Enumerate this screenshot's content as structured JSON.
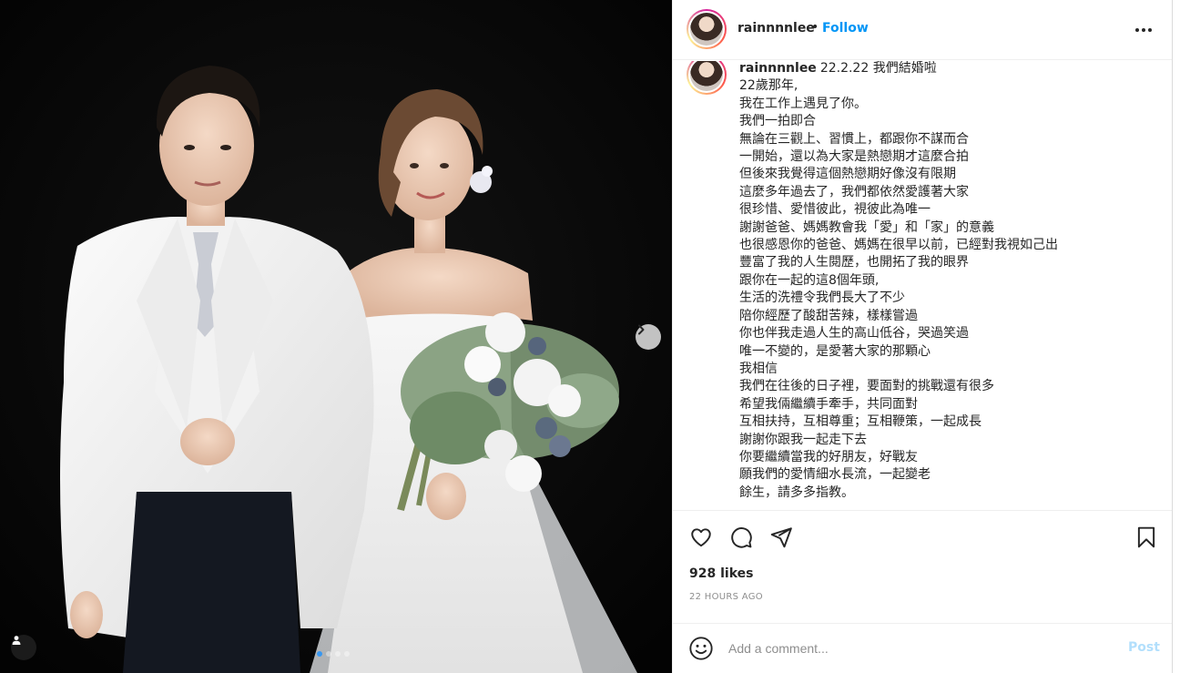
{
  "post": {
    "username": "rainnnnlee",
    "separator": "•",
    "follow_label": "Follow",
    "more_icon": "more-horizontal-icon"
  },
  "caption": {
    "username": "rainnnnlee",
    "lines": [
      "22.2.22 我們結婚啦",
      "22歲那年,",
      "我在工作上遇見了你。",
      "我們一拍即合",
      "無論在三觀上、習慣上，都跟你不謀而合",
      "一開始，還以為大家是熱戀期才這麼合拍",
      "但後來我覺得這個熱戀期好像沒有限期",
      "這麼多年過去了，我們都依然愛護著大家",
      "很珍惜、愛惜彼此，視彼此為唯一",
      "謝謝爸爸、媽媽教會我「愛」和「家」的意義",
      "也很感恩你的爸爸、媽媽在很早以前，已經對我視如己出",
      "豐富了我的人生閱歷，也開拓了我的眼界",
      "跟你在一起的這8個年頭,",
      "生活的洗禮令我們長大了不少",
      "陪你經歷了酸甜苦辣，樣樣嘗過",
      "你也伴我走過人生的高山低谷，哭過笑過",
      "唯一不變的，是愛著大家的那顆心",
      "我相信",
      "我們在往後的日子裡，要面對的挑戰還有很多",
      "希望我倆繼續手牽手，共同面對",
      "互相扶持，互相尊重；互相鞭策，一起成長",
      "謝謝你跟我一起走下去",
      "你要繼續當我的好朋友，好戰友",
      "願我們的愛情細水長流，一起變老",
      "餘生，請多多指教。"
    ]
  },
  "engagement": {
    "likes": "928 likes",
    "time_ago": "22 HOURS AGO"
  },
  "comment": {
    "placeholder": "Add a comment...",
    "post_label": "Post"
  },
  "carousel": {
    "total": 4,
    "current": 1
  },
  "colors": {
    "accent_blue": "#0095f6",
    "post_disabled": "#b2dffc",
    "photo_background": "#060606",
    "muted_text": "#8e8e8e"
  }
}
